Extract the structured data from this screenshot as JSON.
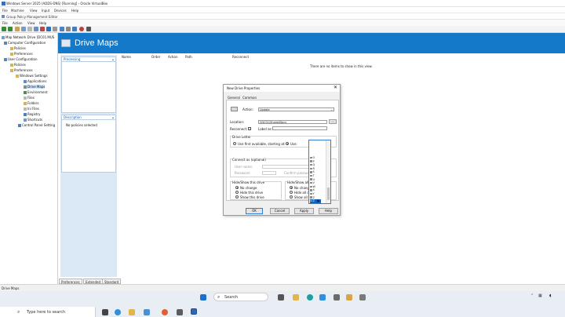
{
  "vbox": {
    "title": "Windows Server 2025 (ADDS-DNS) [Running] - Oracle VirtualBox",
    "menu": [
      "File",
      "Machine",
      "View",
      "Input",
      "Devices",
      "Help"
    ]
  },
  "gpme": {
    "title": "Group Policy Management Editor",
    "menu": [
      "File",
      "Action",
      "View",
      "Help"
    ]
  },
  "tree": {
    "root": "Map Network Drive [DC01.MUS",
    "computer_config": "Computer Configuration",
    "cc_policies": "Policies",
    "cc_preferences": "Preferences",
    "user_config": "User Configuration",
    "uc_policies": "Policies",
    "uc_preferences": "Preferences",
    "windows_settings": "Windows Settings",
    "applications": "Applications",
    "drive_maps": "Drive Maps",
    "environment": "Environment",
    "files": "Files",
    "folders": "Folders",
    "ini_files": "Ini Files",
    "registry": "Registry",
    "shortcuts": "Shortcuts",
    "control_panel": "Control Panel Setting"
  },
  "header": {
    "title": "Drive Maps"
  },
  "left_panels": {
    "processing": "Processing",
    "description": "Description",
    "no_policies": "No policies selected"
  },
  "list": {
    "columns": [
      "Name",
      "Order",
      "Action",
      "Path",
      "Reconnect"
    ],
    "empty": "There are no items to show in this view."
  },
  "tabs": [
    "Preferences",
    "Extended",
    "Standard"
  ],
  "status": "Drive Maps",
  "dialog": {
    "title": "New Drive Properties",
    "close": "✕",
    "tabs": [
      "General",
      "Common"
    ],
    "action_label": "Action:",
    "action_value": "Update",
    "location_label": "Location:",
    "location_value": "\\\\DC01\\SharedDocs",
    "browse": "...",
    "reconnect_label": "Reconnect:",
    "label_as": "Label as:",
    "drive_letter": "Drive Letter",
    "use_first": "Use first available, starting at:",
    "use": "Use:",
    "connect_as": "Connect as (optional)",
    "user_name": "User name:",
    "password": "Password:",
    "confirm_password": "Confirm password:",
    "hide_show_drive": "Hide/Show this drive",
    "hide_show_all": "Hide/Show all d",
    "no_change": "No change",
    "hide_drive": "Hide this drive",
    "show_drive": "Show this drive",
    "no_change_2": "No change",
    "hide_all": "Hide all dri",
    "show_all": "Show all dr",
    "ok": "OK",
    "cancel": "Cancel",
    "apply": "Apply",
    "help": "Help"
  },
  "dropdown": {
    "items": [
      "O",
      "P",
      "Q",
      "R",
      "S",
      "T",
      "U",
      "V",
      "W",
      "X",
      "Y",
      "Z",
      "Z"
    ],
    "highlighted_index": 12
  },
  "taskbar": {
    "search_left": "Type here to search",
    "search_center": "Search"
  },
  "colors": {
    "header_blue": "#1479c9",
    "panel_blue": "#dbe9f6",
    "highlight": "#0a64c8"
  }
}
